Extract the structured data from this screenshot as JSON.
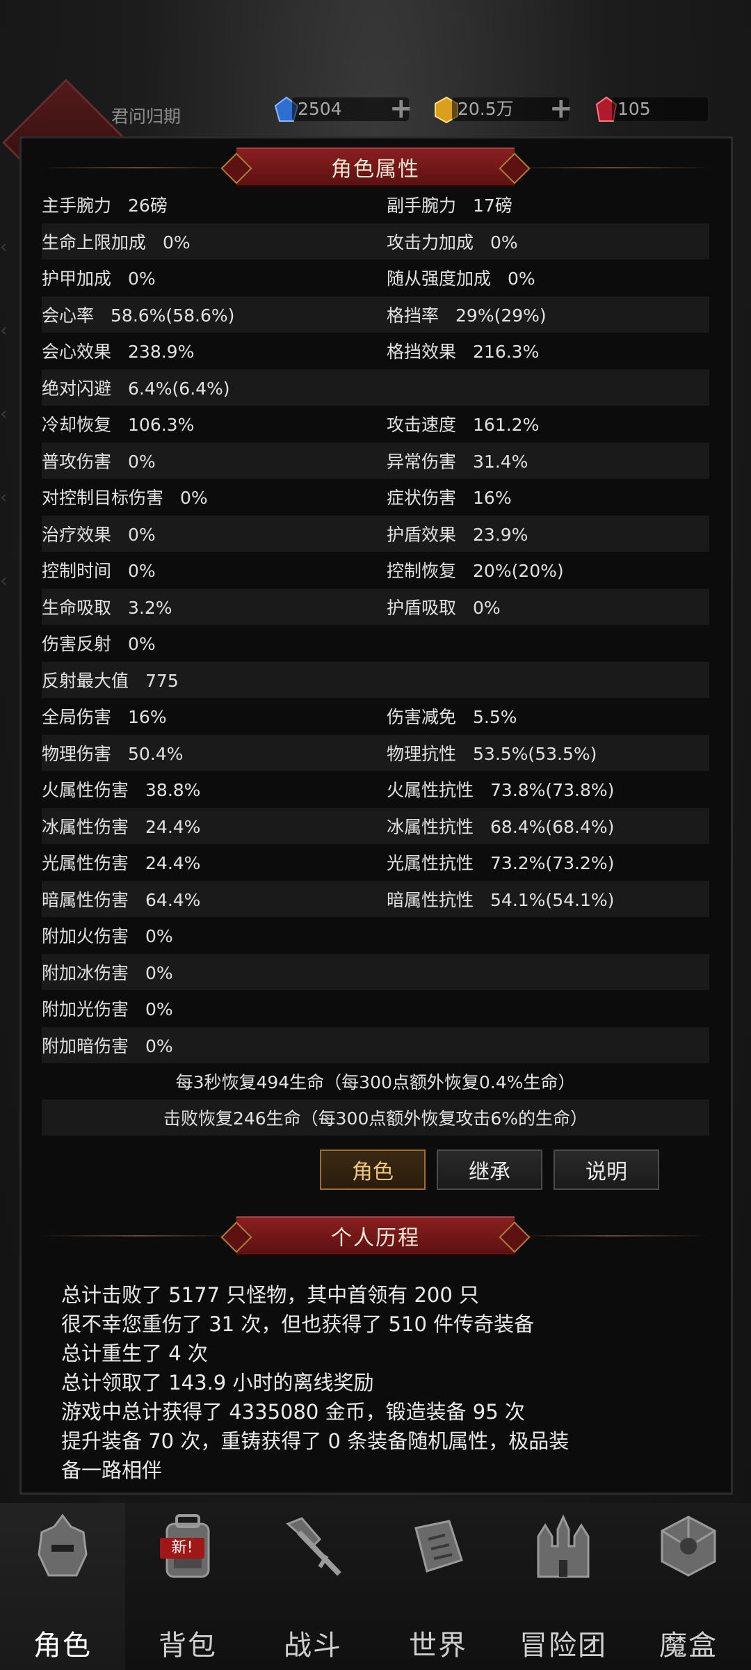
{
  "header": {
    "player_name": "君问归期",
    "resources": [
      {
        "icon": "blue-gem-icon",
        "value": "2504"
      },
      {
        "icon": "gold-coin-icon",
        "value": "20.5万"
      },
      {
        "icon": "red-crystal-icon",
        "value": "105"
      }
    ]
  },
  "panel": {
    "title": "角色属性",
    "stats": [
      {
        "left_label": "主手腕力",
        "left_value": "26磅",
        "right_label": "副手腕力",
        "right_value": "17磅"
      },
      {
        "left_label": "生命上限加成",
        "left_value": "0%",
        "right_label": "攻击力加成",
        "right_value": "0%"
      },
      {
        "left_label": "护甲加成",
        "left_value": "0%",
        "right_label": "随从强度加成",
        "right_value": "0%"
      },
      {
        "left_label": "会心率",
        "left_value": "58.6%(58.6%)",
        "right_label": "格挡率",
        "right_value": "29%(29%)"
      },
      {
        "left_label": "会心效果",
        "left_value": "238.9%",
        "right_label": "格挡效果",
        "right_value": "216.3%"
      },
      {
        "left_label": "绝对闪避",
        "left_value": "6.4%(6.4%)",
        "right_label": "",
        "right_value": ""
      },
      {
        "left_label": "冷却恢复",
        "left_value": "106.3%",
        "right_label": "攻击速度",
        "right_value": "161.2%"
      },
      {
        "left_label": "普攻伤害",
        "left_value": "0%",
        "right_label": "异常伤害",
        "right_value": "31.4%"
      },
      {
        "left_label": "对控制目标伤害",
        "left_value": "0%",
        "right_label": "症状伤害",
        "right_value": "16%"
      },
      {
        "left_label": "治疗效果",
        "left_value": "0%",
        "right_label": "护盾效果",
        "right_value": "23.9%"
      },
      {
        "left_label": "控制时间",
        "left_value": "0%",
        "right_label": "控制恢复",
        "right_value": "20%(20%)"
      },
      {
        "left_label": "生命吸取",
        "left_value": "3.2%",
        "right_label": "护盾吸取",
        "right_value": "0%"
      },
      {
        "left_label": "伤害反射",
        "left_value": "0%",
        "right_label": "",
        "right_value": ""
      },
      {
        "left_label": "反射最大值",
        "left_value": "775",
        "right_label": "",
        "right_value": ""
      },
      {
        "left_label": "全局伤害",
        "left_value": "16%",
        "right_label": "伤害减免",
        "right_value": "5.5%"
      },
      {
        "left_label": "物理伤害",
        "left_value": "50.4%",
        "right_label": "物理抗性",
        "right_value": "53.5%(53.5%)"
      },
      {
        "left_label": "火属性伤害",
        "left_value": "38.8%",
        "right_label": "火属性抗性",
        "right_value": "73.8%(73.8%)"
      },
      {
        "left_label": "冰属性伤害",
        "left_value": "24.4%",
        "right_label": "冰属性抗性",
        "right_value": "68.4%(68.4%)"
      },
      {
        "left_label": "光属性伤害",
        "left_value": "24.4%",
        "right_label": "光属性抗性",
        "right_value": "73.2%(73.2%)"
      },
      {
        "left_label": "暗属性伤害",
        "left_value": "64.4%",
        "right_label": "暗属性抗性",
        "right_value": "54.1%(54.1%)"
      },
      {
        "left_label": "附加火伤害",
        "left_value": "0%",
        "right_label": "",
        "right_value": ""
      },
      {
        "left_label": "附加冰伤害",
        "left_value": "0%",
        "right_label": "",
        "right_value": ""
      },
      {
        "left_label": "附加光伤害",
        "left_value": "0%",
        "right_label": "",
        "right_value": ""
      },
      {
        "left_label": "附加暗伤害",
        "left_value": "0%",
        "right_label": "",
        "right_value": ""
      }
    ],
    "regen_line": "每3秒恢复494生命（每300点额外恢复0.4%生命）",
    "kill_line": "击败恢复246生命（每300点额外恢复攻击6%的生命）",
    "tabs": [
      "角色",
      "继承",
      "说明"
    ],
    "active_tab": "角色",
    "history_title": "个人历程",
    "history": [
      "总计击败了 5177 只怪物，其中首领有 200 只",
      "很不幸您重伤了 31 次，但也获得了 510 件传奇装备",
      "总计重生了 4 次",
      "总计领取了 143.9 小时的离线奖励",
      "游戏中总计获得了 4335080 金币，锻造装备 95 次",
      "提升装备 70 次，重铸获得了 0 条装备随机属性，极品装",
      "备一路相伴"
    ]
  },
  "bottom_nav": {
    "items": [
      {
        "label": "角色",
        "icon": "helmet-icon"
      },
      {
        "label": "背包",
        "icon": "backpack-icon",
        "badge": "新!"
      },
      {
        "label": "战斗",
        "icon": "crossed-swords-icon"
      },
      {
        "label": "世界",
        "icon": "map-scroll-icon"
      },
      {
        "label": "冒险团",
        "icon": "castle-icon"
      },
      {
        "label": "魔盒",
        "icon": "magic-cube-icon"
      }
    ],
    "active": "角色"
  },
  "colors": {
    "panel_bg": "#0c0c0c",
    "ribbon": "#8a1f1f",
    "active_tab_text": "#f3c77a",
    "badge": "#a11717"
  }
}
